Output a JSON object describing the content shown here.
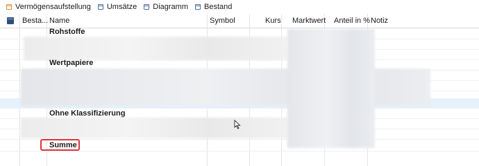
{
  "tabs": [
    {
      "label": "Vermögensaufstellung",
      "icon": "table-icon",
      "active": true
    },
    {
      "label": "Umsätze",
      "icon": "table-icon",
      "active": false
    },
    {
      "label": "Diagramm",
      "icon": "table-icon",
      "active": false
    },
    {
      "label": "Bestand",
      "icon": "table-icon",
      "active": false
    }
  ],
  "columns": {
    "bestand": "Besta...",
    "name": "Name",
    "symbol": "Symbol",
    "kurs": "Kurs",
    "marktwert": "Marktwert",
    "anteil": "Anteil in %",
    "notiz": "Notiz"
  },
  "groups": {
    "rohstoffe": "Rohstoffe",
    "wertpapiere": "Wertpapiere",
    "ohne": "Ohne Klassifizierung"
  },
  "summe": "Summe",
  "colors": {
    "accent_tab": "#e8892b",
    "icon_blue": "#4a6d9c",
    "highlight_row": "#e5f1fb",
    "annotation_red": "#e0333a"
  }
}
